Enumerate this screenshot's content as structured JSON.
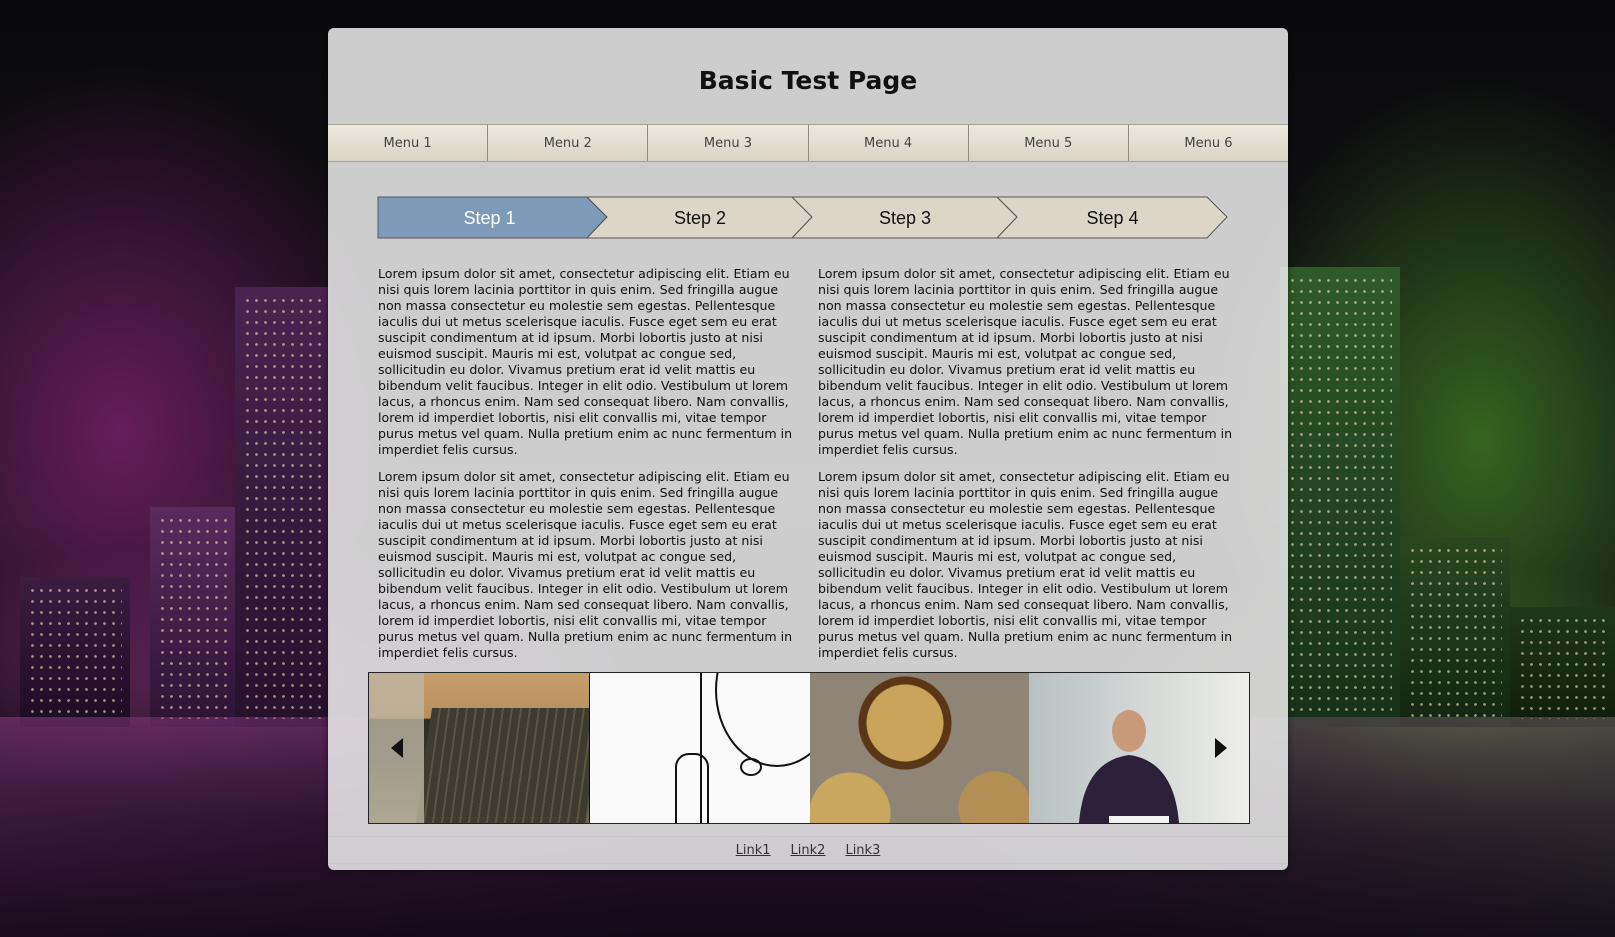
{
  "page": {
    "title": "Basic Test Page"
  },
  "menu": [
    "Menu 1",
    "Menu 2",
    "Menu 3",
    "Menu 4",
    "Menu 5",
    "Menu 6"
  ],
  "steps": {
    "items": [
      "Step 1",
      "Step 2",
      "Step 3",
      "Step 4"
    ],
    "active_index": 0,
    "active_color": "#7e9ab9",
    "inactive_color": "#dcd6c9"
  },
  "content": {
    "paragraph": "Lorem ipsum dolor sit amet, consectetur adipiscing elit. Etiam eu nisi quis lorem lacinia porttitor in quis enim. Sed fringilla augue non massa consectetur eu molestie sem egestas. Pellentesque iaculis dui ut metus scelerisque iaculis. Fusce eget sem eu erat suscipit condimentum at id ipsum. Morbi lobortis justo at nisi euismod suscipit. Mauris mi est, volutpat ac congue sed, sollicitudin eu dolor. Vivamus pretium erat id velit mattis eu bibendum velit faucibus. Integer in elit odio. Vestibulum ut lorem lacus, a rhoncus enim. Nam sed consequat libero. Nam convallis, lorem id imperdiet lobortis, nisi elit convallis mi, vitae tempor purus metus vel quam. Nulla pretium enim ac nunc fermentum in imperdiet felis cursus."
  },
  "gallery": {
    "prev_icon": "triangle-left",
    "next_icon": "triangle-right"
  },
  "footer": {
    "links": [
      "Link1",
      "Link2",
      "Link3"
    ]
  }
}
